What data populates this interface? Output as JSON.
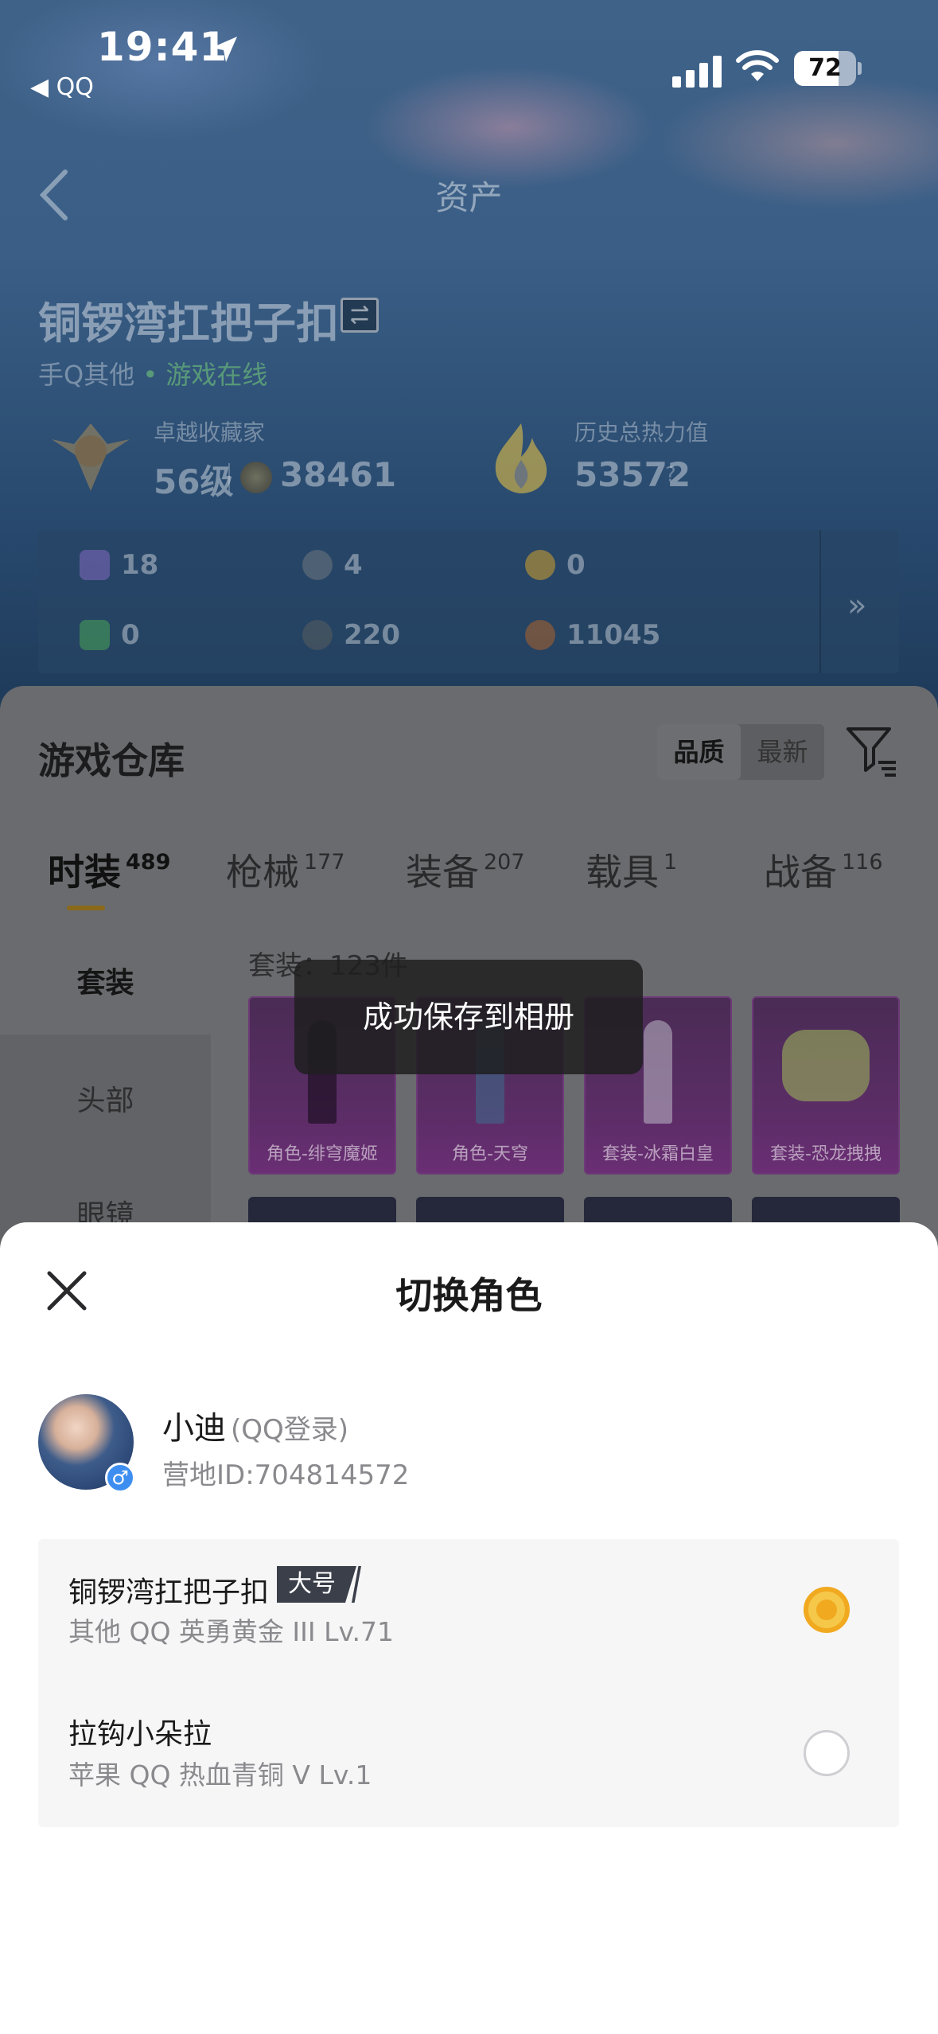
{
  "status_bar": {
    "time": "19:41",
    "back_app": "◀ QQ",
    "battery": "72"
  },
  "nav": {
    "title": "资产"
  },
  "profile": {
    "role_name": "铜锣湾扛把子扣",
    "platform": "手Q其他",
    "online_status": "• 游戏在线",
    "collector_label": "卓越收藏家",
    "collector_level": "56级",
    "coins": "38461",
    "heat_label": "历史总热力值",
    "heat_value": "53572",
    "heat_help": "?"
  },
  "resources": {
    "items": [
      {
        "icon": "card-icon",
        "value": "18",
        "color": "#6b5fa8"
      },
      {
        "icon": "coin-s-icon",
        "value": "4",
        "color": "#5c6a78"
      },
      {
        "icon": "coin-a-icon",
        "value": "0",
        "color": "#a58a3c"
      },
      {
        "icon": "ticket-icon",
        "value": "0",
        "color": "#3f8a5a"
      },
      {
        "icon": "orb-icon",
        "value": "220",
        "color": "#4a5660"
      },
      {
        "icon": "medal-icon",
        "value": "11045",
        "color": "#8a5a3a"
      }
    ],
    "more": "»"
  },
  "warehouse": {
    "title": "游戏仓库",
    "sort_options": [
      "品质",
      "最新"
    ],
    "tabs": [
      {
        "label": "时装",
        "count": "489"
      },
      {
        "label": "枪械",
        "count": "177"
      },
      {
        "label": "装备",
        "count": "207"
      },
      {
        "label": "载具",
        "count": "1"
      },
      {
        "label": "战备",
        "count": "116"
      }
    ],
    "side_menu": [
      "套装",
      "头部",
      "眼镜"
    ],
    "suit_count": "套装：123件",
    "cards": [
      "角色-绯穹魔姬",
      "角色-天穹",
      "套装-冰霜白皇",
      "套装-恐龙拽拽"
    ]
  },
  "toast": {
    "message": "成功保存到相册"
  },
  "sheet": {
    "title": "切换角色",
    "user": {
      "name": "小迪",
      "login": "(QQ登录)",
      "camp_id": "营地ID:704814572",
      "gender": "♂"
    },
    "roles": [
      {
        "name": "铜锣湾扛把子扣",
        "badge": "大号",
        "detail": "其他 QQ   英勇黄金 III   Lv.71",
        "selected": true
      },
      {
        "name": "拉钩小朵拉",
        "badge": "",
        "detail": "苹果 QQ   热血青铜 V   Lv.1",
        "selected": false
      }
    ]
  },
  "colors": {
    "accent_radio": "#f1a920",
    "badge_bg": "#3a3f4a",
    "card_purple": "#5b2d66"
  }
}
